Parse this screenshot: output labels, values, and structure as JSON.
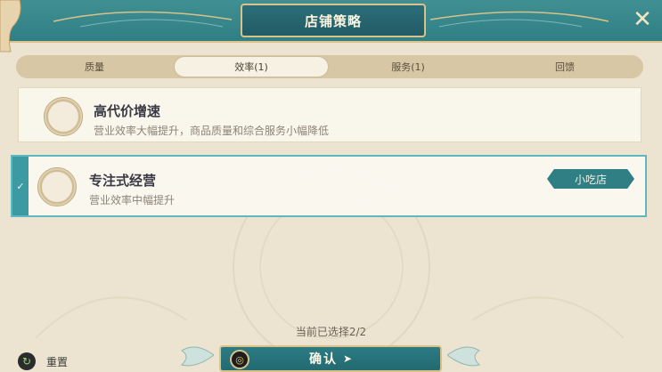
{
  "header": {
    "title": "店铺策略"
  },
  "tabs": [
    {
      "label": "质量",
      "active": false
    },
    {
      "label": "效率(1)",
      "active": true
    },
    {
      "label": "服务(1)",
      "active": false
    },
    {
      "label": "回馈",
      "active": false
    }
  ],
  "strategies": [
    {
      "title": "高代价增速",
      "desc": "营业效率大幅提升，商品质量和综合服务小幅降低",
      "selected": false
    },
    {
      "title": "专注式经营",
      "desc": "营业效率中幅提升",
      "selected": true,
      "badge": "小吃店"
    }
  ],
  "footer": {
    "selection_count": "当前已选择2/2",
    "reset_label": "重置",
    "confirm_label": "确认"
  },
  "colors": {
    "accent": "#2f7f84",
    "highlight_border": "#5fb8c0",
    "gold_trim": "#d9c28a"
  }
}
